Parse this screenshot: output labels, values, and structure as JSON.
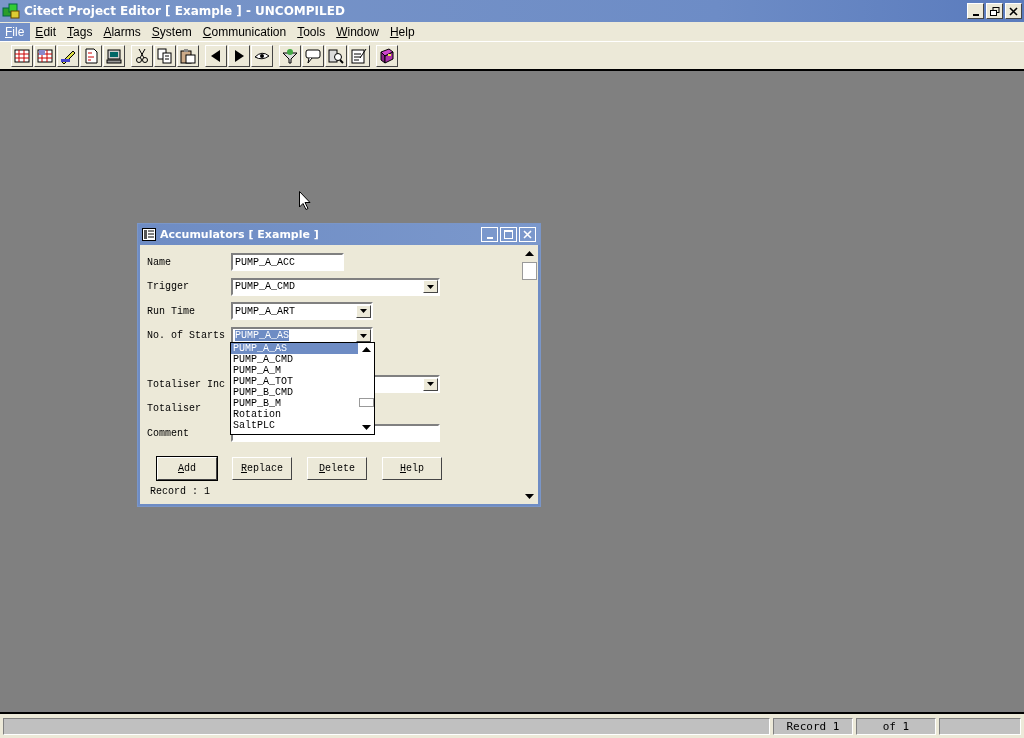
{
  "app_window": {
    "title": "Citect Project Editor [ Example ] - UNCOMPILED"
  },
  "menu": [
    {
      "label": "File",
      "selected": true
    },
    {
      "label": "Edit",
      "selected": false
    },
    {
      "label": "Tags",
      "selected": false
    },
    {
      "label": "Alarms",
      "selected": false
    },
    {
      "label": "System",
      "selected": false
    },
    {
      "label": "Communication",
      "selected": false
    },
    {
      "label": "Tools",
      "selected": false
    },
    {
      "label": "Window",
      "selected": false
    },
    {
      "label": "Help",
      "selected": false
    }
  ],
  "child_window": {
    "title": "Accumulators [ Example ]",
    "fields": [
      {
        "kind": "text",
        "label": "Name",
        "value": "PUMP_A_ACC"
      },
      {
        "kind": "wide-combo",
        "label": "Trigger",
        "value": "PUMP_A_CMD"
      },
      {
        "kind": "combo",
        "label": "Run Time",
        "value": "PUMP_A_ART"
      },
      {
        "kind": "combo",
        "label": "No. of Starts",
        "value": "PUMP_A_AS",
        "highlighted": true
      },
      {
        "kind": "wide-combo",
        "label": "Totaliser Inc"
      },
      {
        "kind": "covered",
        "label": "Totaliser"
      },
      {
        "kind": "wide-text",
        "label": "Comment"
      }
    ],
    "dropdown": {
      "items": [
        {
          "label": "PUMP_A_AS",
          "selected": true
        },
        {
          "label": "PUMP_A_CMD",
          "selected": false
        },
        {
          "label": "PUMP_A_M",
          "selected": false
        },
        {
          "label": "PUMP_A_TOT",
          "selected": false
        },
        {
          "label": "PUMP_B_CMD",
          "selected": false
        },
        {
          "label": "PUMP_B_M",
          "selected": false
        },
        {
          "label": "Rotation",
          "selected": false
        },
        {
          "label": "SaltPLC",
          "selected": false
        }
      ]
    },
    "buttons": [
      {
        "label": "Add",
        "default": true
      },
      {
        "label": "Replace",
        "default": false
      },
      {
        "label": "Delete",
        "default": false
      },
      {
        "label": "Help",
        "default": false
      }
    ],
    "record": "Record : 1"
  },
  "status_bar": [
    {
      "text": "Record 1"
    },
    {
      "text": "of 1"
    }
  ]
}
